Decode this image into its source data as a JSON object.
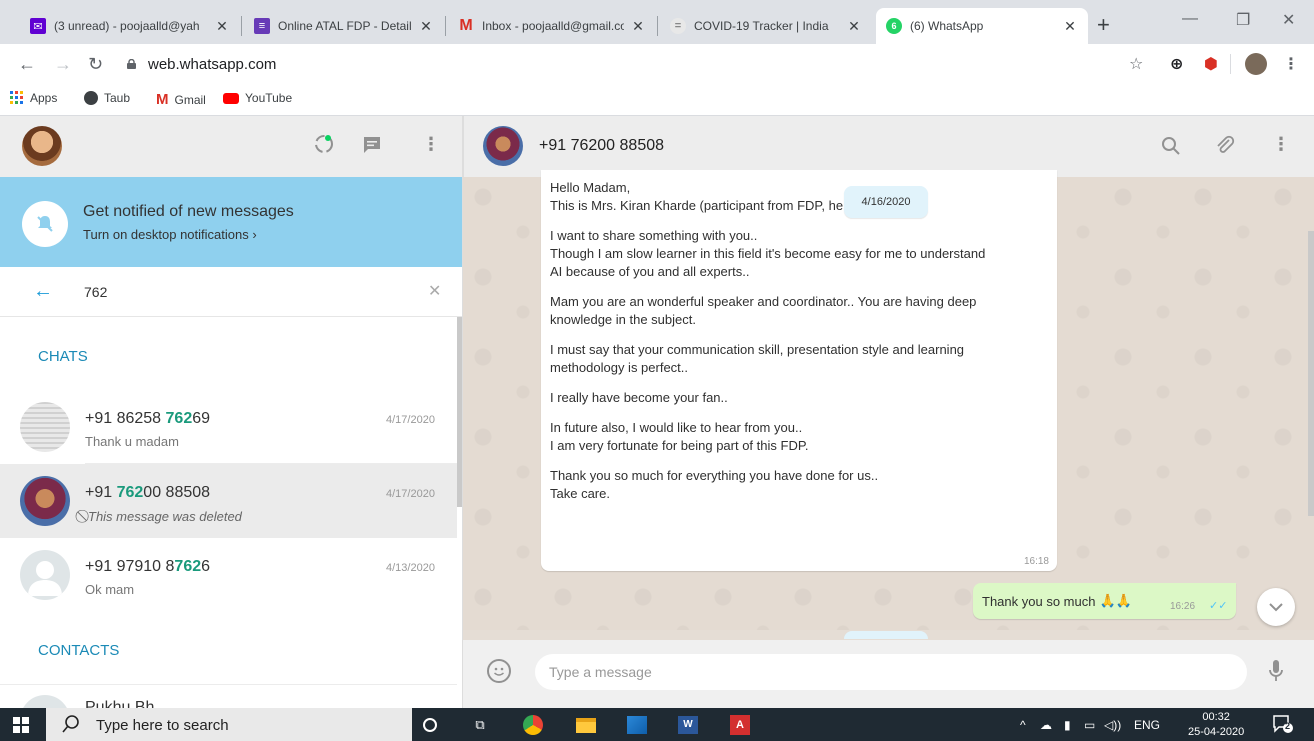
{
  "browser": {
    "tabs": [
      {
        "title": "(3 unread) - poojaalld@yah",
        "icon": "mail-icon",
        "color": "#6001d2"
      },
      {
        "title": "Online ATAL FDP - Details R",
        "icon": "form-icon",
        "color": "#673ab7"
      },
      {
        "title": "Inbox - poojaalld@gmail.co",
        "icon": "gmail-icon",
        "color": "#d93025"
      },
      {
        "title": "COVID-19 Tracker | India",
        "icon": "covid-icon",
        "color": "#b0b0b0"
      },
      {
        "title": "(6) WhatsApp",
        "icon": "whatsapp-icon",
        "color": "#25d366",
        "active": true
      }
    ],
    "url": "web.whatsapp.com",
    "bookmarks": [
      {
        "label": "Apps",
        "icon": "apps-grid-icon"
      },
      {
        "label": "Taub",
        "icon": "globe-icon"
      },
      {
        "label": "Gmail",
        "icon": "gmail-icon"
      },
      {
        "label": "YouTube",
        "icon": "youtube-icon"
      }
    ]
  },
  "sidebar": {
    "notification": {
      "title": "Get notified of new messages",
      "subtitle": "Turn on desktop notifications ›"
    },
    "search": {
      "value": "762"
    },
    "chats_label": "CHATS",
    "contacts_label": "CONTACTS",
    "chats": [
      {
        "name_pre": "+91 86258 ",
        "name_hl": "762",
        "name_post": "69",
        "date": "4/17/2020",
        "preview": "Thank u madam",
        "deleted": false
      },
      {
        "name_pre": "+91 ",
        "name_hl": "762",
        "name_post": "00 88508",
        "date": "4/17/2020",
        "preview": "This message was deleted",
        "deleted": true
      },
      {
        "name_pre": "+91 97910 8",
        "name_hl": "762",
        "name_post": "6",
        "date": "4/13/2020",
        "preview": "Ok mam",
        "deleted": false
      }
    ],
    "contact_partial": "Pukhu Bh..."
  },
  "conversation": {
    "contact_name": "+91 76200 88508",
    "date_chip": "4/16/2020",
    "incoming": {
      "lines": [
        "Hello Madam,",
        "This is Mrs. Kiran Kharde (participant from FDP, here",
        "",
        "I want to share something with you..",
        "Though I am slow learner in this field it's become easy for me to understand",
        "AI because of you and all experts..",
        "",
        "Mam you are  an wonderful speaker and coordinator.. You are having deep",
        "knowledge in the subject.",
        "",
        "I must say that your communication skill, presentation style and learning",
        "methodology is perfect..",
        "",
        "I really have become your fan..",
        "",
        "In future also, I would like to hear from you..",
        "I am very fortunate  for being part of this FDP.",
        "",
        "Thank you so much for everything you have done for us..",
        "Take care."
      ],
      "time": "16:18"
    },
    "outgoing": {
      "text": "Thank you so much",
      "emoji": "🙏🙏",
      "time": "16:26"
    },
    "composer_placeholder": "Type a message"
  },
  "taskbar": {
    "search_placeholder": "Type here to search",
    "tray_lang": "ENG",
    "time": "00:32",
    "date": "25-04-2020",
    "notification_count": "2"
  },
  "colors": {
    "accent": "#1a9a7c",
    "notification_banner": "#8fd0ee",
    "outgoing_bubble": "#dcf8c6",
    "taskbar": "#1f2a33"
  }
}
